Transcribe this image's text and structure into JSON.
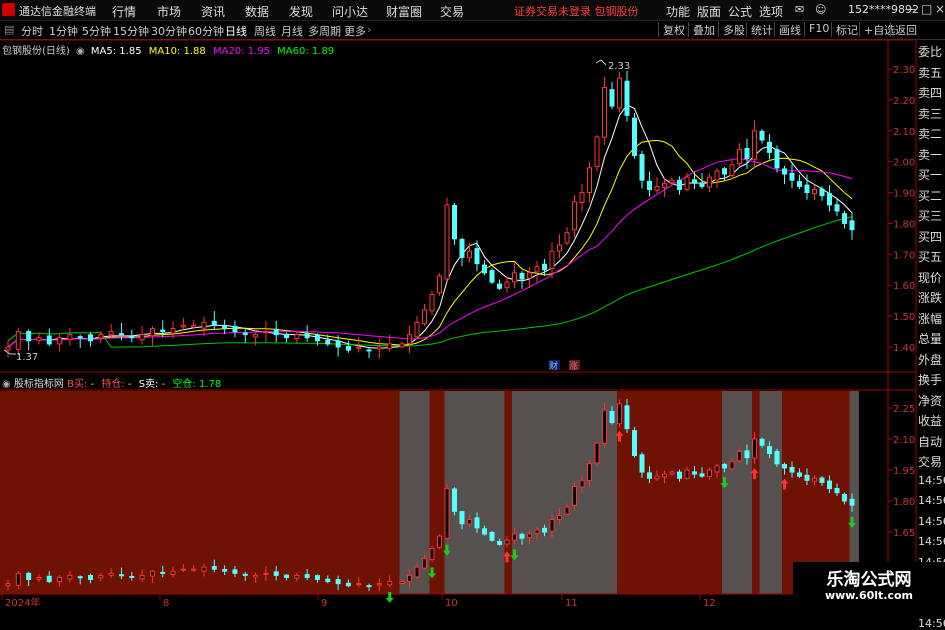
{
  "app": {
    "title": "通达信金融终端"
  },
  "menu": [
    "行情",
    "市场",
    "资讯",
    "数据",
    "发现",
    "问小达",
    "财富圈",
    "交易"
  ],
  "login_status": "证券交易未登录 包钢股份",
  "right_menu": [
    "功能",
    "版面",
    "公式",
    "选项"
  ],
  "account": "152****9892",
  "toolbar": {
    "periods": [
      "分时",
      "1分钟",
      "5分钟",
      "15分钟",
      "30分钟",
      "60分钟",
      "日线",
      "周线",
      "月线",
      "多周期",
      "更多"
    ],
    "active": "日线",
    "right": [
      "复权",
      "叠加",
      "多股",
      "统计",
      "画线",
      "F10",
      "标记",
      "+自选",
      "返回"
    ]
  },
  "chart_header": {
    "stock": "包钢股份(日线)",
    "ma": [
      {
        "label": "MA5: 1.85",
        "color": "#ffffff"
      },
      {
        "label": "MA10: 1.88",
        "color": "#ffff00"
      },
      {
        "label": "MA20: 1.95",
        "color": "#ff00ff"
      },
      {
        "label": "MA60: 1.89",
        "color": "#00ff00"
      }
    ]
  },
  "indicator_header": {
    "name": "股标指标网",
    "items": [
      {
        "label": "B买:",
        "color": "#ff5050"
      },
      {
        "label": "-",
        "color": "#ffff00"
      },
      {
        "label": "持仓:",
        "color": "#ff5050"
      },
      {
        "label": "-",
        "color": "#ffff00"
      },
      {
        "label": "S卖:",
        "color": "#ffffff"
      },
      {
        "label": "-",
        "color": "#ffff00"
      },
      {
        "label": "空仓:",
        "color": "#00ff00"
      },
      {
        "label": "1.78",
        "color": "#00ff00"
      }
    ]
  },
  "annotations": {
    "high": "2.33",
    "low": "1.37",
    "cai": "财",
    "zhang": "涨"
  },
  "side_panel": [
    "委比",
    "卖五",
    "卖四",
    "卖三",
    "卖二",
    "卖一",
    "买一",
    "买二",
    "买三",
    "买四",
    "买五",
    "现价",
    "涨跌",
    "涨幅",
    "总量",
    "外盘",
    "换手",
    "净资",
    "收益",
    "自动",
    "交易",
    "14:56",
    "14:56",
    "14:56",
    "14:56",
    "14:56",
    "14:56",
    "14:56",
    "14:56"
  ],
  "watermark": {
    "title": "乐淘公式网",
    "url": "www.60lt.com"
  },
  "colors": {
    "up": "#ff3232",
    "down": "#54ffff",
    "ma5": "#ffffff",
    "ma10": "#ffff00",
    "ma20": "#ff00ff",
    "ma60": "#00c800",
    "hold_zone": "#6e1204",
    "flat_zone": "#56504e"
  },
  "chart_data": {
    "type": "candlestick",
    "main": {
      "y_ticks": [
        "2.30",
        "2.20",
        "2.10",
        "2.00",
        "1.90",
        "1.80",
        "1.70",
        "1.60",
        "1.50",
        "1.40"
      ],
      "ylim": [
        1.35,
        2.35
      ]
    },
    "indicator": {
      "y_ticks": [
        "2.25",
        "2.10",
        "1.95",
        "1.80",
        "1.65"
      ],
      "ylim": [
        1.36,
        2.35
      ]
    },
    "x_labels": [
      "2024年",
      "8",
      "9",
      "10",
      "11",
      "12"
    ],
    "price_path": [
      [
        1.4,
        1.45,
        1.42,
        1.43,
        1.41,
        1.43,
        1.44,
        1.43,
        1.42,
        1.44,
        1.45,
        1.44,
        1.43,
        1.44,
        1.46,
        1.45,
        1.46,
        1.47,
        1.47,
        1.48,
        1.47,
        1.46,
        1.45,
        1.44,
        1.44,
        1.45,
        1.44,
        1.43,
        1.44,
        1.43,
        1.42,
        1.41,
        1.4,
        1.39,
        1.4,
        1.39,
        1.4,
        1.41
      ],
      [
        1.41,
        1.44,
        1.48,
        1.52,
        1.57,
        1.63,
        1.86,
        1.75,
        1.69,
        1.71,
        1.67,
        1.64,
        1.61,
        1.59,
        1.61,
        1.64,
        1.62,
        1.64,
        1.66,
        1.65,
        1.71,
        1.73,
        1.77,
        1.87,
        1.9,
        1.98,
        2.08,
        2.24,
        2.18,
        2.27,
        2.15,
        2.02,
        1.94,
        1.91,
        1.92,
        1.93,
        1.94,
        1.91,
        1.95,
        1.93,
        1.92,
        1.95,
        1.97,
        1.96,
        1.99,
        2.04,
        2.01,
        2.1,
        2.07,
        2.03,
        1.98,
        1.96,
        1.94,
        1.92,
        1.9,
        1.91,
        1.89,
        1.86,
        1.84,
        1.8,
        1.78
      ]
    ],
    "segment_counts": [
      38,
      61
    ],
    "zones": [
      {
        "type": "hold",
        "from": 0,
        "to": 38
      },
      {
        "type": "flat",
        "from": 38,
        "to": 42
      },
      {
        "type": "hold",
        "from": 42,
        "to": 44
      },
      {
        "type": "flat",
        "from": 44,
        "to": 52
      },
      {
        "type": "hold",
        "from": 52,
        "to": 53
      },
      {
        "type": "flat",
        "from": 53,
        "to": 67
      },
      {
        "type": "hold",
        "from": 67,
        "to": 81
      },
      {
        "type": "flat",
        "from": 81,
        "to": 85
      },
      {
        "type": "hold",
        "from": 85,
        "to": 86
      },
      {
        "type": "flat",
        "from": 86,
        "to": 89
      },
      {
        "type": "hold",
        "from": 89,
        "to": 98
      },
      {
        "type": "flat",
        "from": 98,
        "to": 118
      },
      {
        "type": "hold",
        "from": 118,
        "to": 123
      },
      {
        "type": "flat",
        "from": 123,
        "to": 142
      }
    ],
    "buy_marks": [
      52,
      67,
      85,
      89,
      118
    ],
    "sell_marks": [
      37,
      42,
      44,
      53,
      81,
      98,
      123
    ]
  }
}
